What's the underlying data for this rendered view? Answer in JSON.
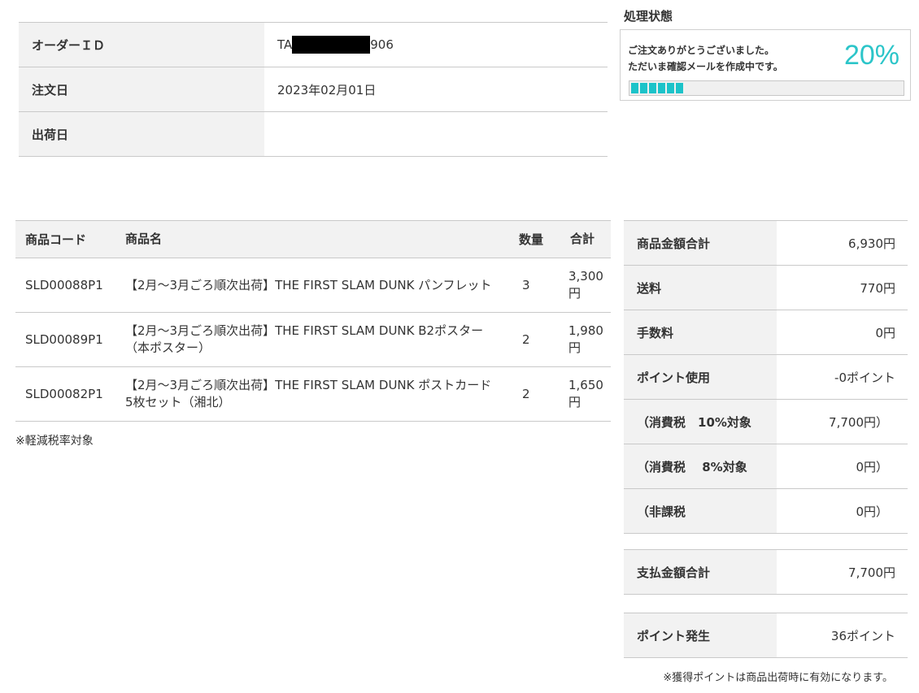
{
  "order": {
    "rows": [
      {
        "label": "オーダーＩＤ",
        "value_prefix": "TA",
        "value_suffix": "906"
      },
      {
        "label": "注文日",
        "value": "2023年02月01日"
      },
      {
        "label": "出荷日",
        "value": ""
      }
    ]
  },
  "status": {
    "title": "処理状態",
    "message_line1": "ご注文ありがとうございました。",
    "message_line2": "ただいま確認メールを作成中です。",
    "percent_label": "20%",
    "progress": 0.2,
    "accent_color": "#2cc5c9"
  },
  "items": {
    "headers": [
      "商品コード",
      "商品名",
      "数量",
      "合計"
    ],
    "rows": [
      {
        "code": "SLD00088P1",
        "name": "【2月～3月ごろ順次出荷】THE FIRST SLAM DUNK パンフレット",
        "qty": "3",
        "total": "3,300円"
      },
      {
        "code": "SLD00089P1",
        "name": "【2月～3月ごろ順次出荷】THE FIRST SLAM DUNK B2ポスター（本ポスター）",
        "qty": "2",
        "total": "1,980円"
      },
      {
        "code": "SLD00082P1",
        "name": "【2月～3月ごろ順次出荷】THE FIRST SLAM DUNK ポストカード5枚セット（湘北）",
        "qty": "2",
        "total": "1,650円"
      }
    ],
    "note": "※軽減税率対象"
  },
  "summary": {
    "rows": [
      {
        "label": "商品金額合計",
        "value": "6,930円"
      },
      {
        "label": "送料",
        "value": "770円"
      },
      {
        "label": "手数料",
        "value": "0円"
      },
      {
        "label": "ポイント使用",
        "value": "-0ポイント"
      },
      {
        "label": "（消費税　10%対象",
        "value": "7,700円）"
      },
      {
        "label": "（消費税　 8%対象",
        "value": "0円）"
      },
      {
        "label": "（非課税",
        "value": "0円）"
      }
    ],
    "payment_total": {
      "label": "支払金額合計",
      "value": "7,700円"
    },
    "points_earned": {
      "label": "ポイント発生",
      "value": "36ポイント"
    },
    "points_note": "※獲得ポイントは商品出荷時に有効になります。"
  }
}
